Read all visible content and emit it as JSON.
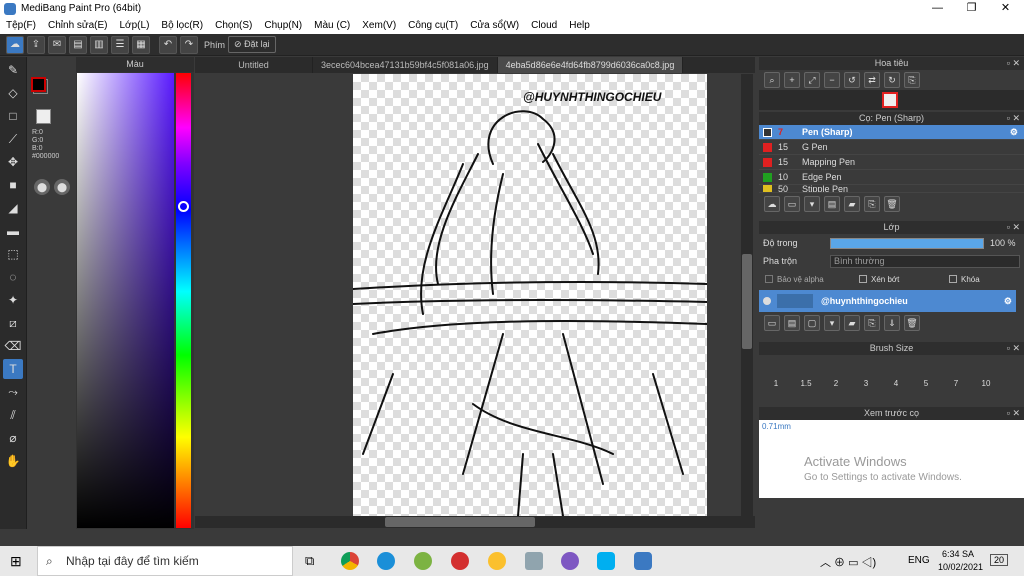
{
  "window": {
    "title": "MediBang Paint Pro (64bit)"
  },
  "menu": [
    "Tệp(F)",
    "Chỉnh sửa(E)",
    "Lớp(L)",
    "Bộ lọc(R)",
    "Chọn(S)",
    "Chụp(N)",
    "Màu (C)",
    "Xem(V)",
    "Công cụ(T)",
    "Cửa sổ(W)",
    "Cloud",
    "Help"
  ],
  "toolbar": {
    "phim_label": "Phím",
    "reset_label": "Đặt lại"
  },
  "color_panel": {
    "title": "Màu",
    "fg_color": "#000000",
    "bg_color": "#5a1bff",
    "rgb": [
      "R:0",
      "G:0",
      "B:0"
    ],
    "hex": "#000000"
  },
  "tabs": [
    "Untitled",
    "3ecec604bcea47131b59bf4c5f081a06.jpg",
    "4eba5d86e6e4fd64fb8799d6036ca0c8.jpg"
  ],
  "canvas": {
    "watermark": "@HUYNHTHINGOCHIEU"
  },
  "navigator": {
    "title": "Hoa tiêu"
  },
  "brush_panel": {
    "title": "Cọ: Pen (Sharp)",
    "brushes": [
      {
        "size": "7",
        "name": "Pen (Sharp)",
        "color": "#333333"
      },
      {
        "size": "15",
        "name": "G Pen",
        "color": "#e02020"
      },
      {
        "size": "15",
        "name": "Mapping Pen",
        "color": "#e02020"
      },
      {
        "size": "10",
        "name": "Edge Pen",
        "color": "#20a020"
      },
      {
        "size": "50",
        "name": "Stipple Pen",
        "color": "#e0c020"
      }
    ]
  },
  "layer_panel": {
    "title": "Lớp",
    "opacity_label": "Độ trong",
    "opacity_value": "100 %",
    "opacity": 1.0,
    "blend_label": "Pha trộn",
    "blend_value": "Bình thường",
    "protect_alpha": "Bảo vệ alpha",
    "clipping": "Xén bớt",
    "lock": "Khóa",
    "layer_name": "@huynhthingochieu"
  },
  "brush_size": {
    "title": "Brush Size",
    "sizes": [
      "1",
      "1.5",
      "2",
      "3",
      "4",
      "5",
      "7",
      "10"
    ]
  },
  "preview": {
    "title": "Xem trước cọ",
    "size": "0.71mm"
  },
  "activation": {
    "line1": "Activate Windows",
    "line2": "Go to Settings to activate Windows."
  },
  "taskbar": {
    "search_placeholder": "Nhập tại đây để tìm kiếm",
    "time": "6:34 SA",
    "date": "10/02/2021",
    "lang": "ENG",
    "notifications": "20"
  }
}
